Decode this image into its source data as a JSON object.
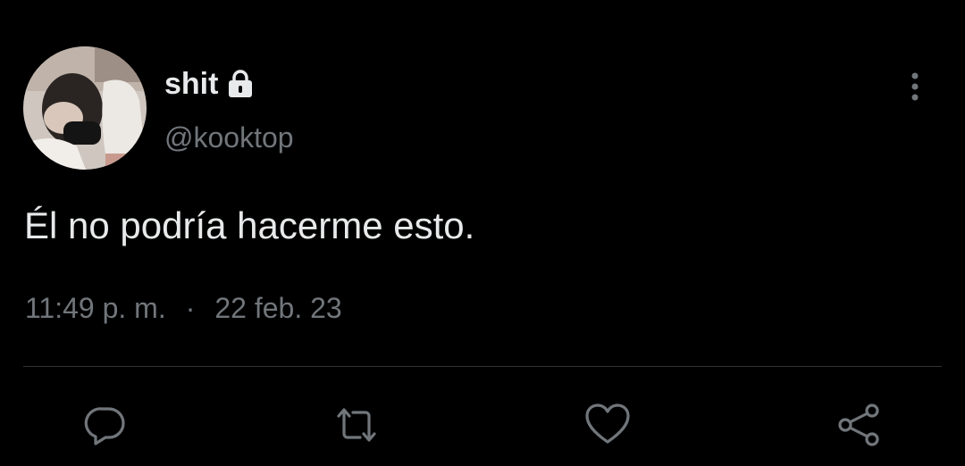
{
  "tweet": {
    "author": {
      "display_name": "shit",
      "handle": "@kooktop",
      "protected_icon": "lock-icon",
      "avatar": "avatar-photo"
    },
    "text": "Él no podría hacerme esto.",
    "time": "11:49 p. m.",
    "separator": "·",
    "date": "22 feb. 23"
  },
  "actions": [
    {
      "name": "reply",
      "icon": "reply-icon"
    },
    {
      "name": "retweet",
      "icon": "retweet-icon"
    },
    {
      "name": "like",
      "icon": "heart-icon"
    },
    {
      "name": "share",
      "icon": "share-icon"
    }
  ],
  "menu_icon": "more-vertical-icon",
  "colors": {
    "background": "#000000",
    "primary_text": "#e7e9ea",
    "secondary_text": "#71767b",
    "divider": "#2f3336"
  }
}
